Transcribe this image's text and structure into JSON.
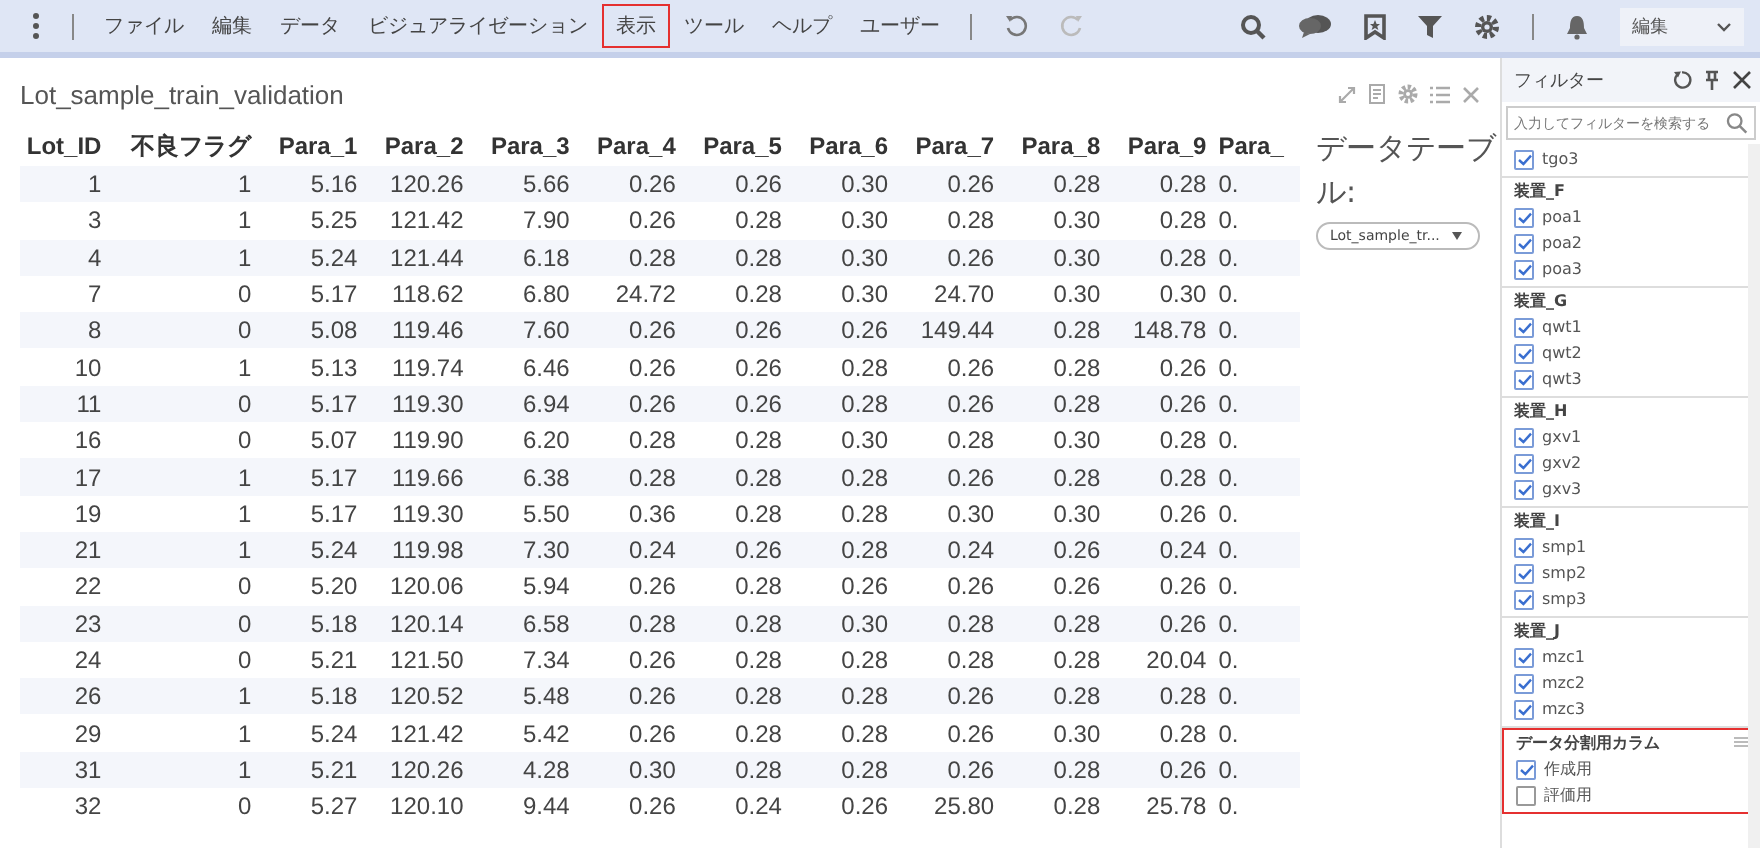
{
  "menu_bar": {
    "items": [
      {
        "label": "ファイル",
        "highlighted": false
      },
      {
        "label": "編集",
        "highlighted": false
      },
      {
        "label": "データ",
        "highlighted": false
      },
      {
        "label": "ビジュアライゼーション",
        "highlighted": false
      },
      {
        "label": "表示",
        "highlighted": true
      },
      {
        "label": "ツール",
        "highlighted": false
      },
      {
        "label": "ヘルプ",
        "highlighted": false
      },
      {
        "label": "ユーザー",
        "highlighted": false
      }
    ],
    "mode_dropdown": "編集"
  },
  "visualization": {
    "title": "Lot_sample_train_validation",
    "table": {
      "columns": [
        "Lot_ID",
        "不良フラグ",
        "Para_1",
        "Para_2",
        "Para_3",
        "Para_4",
        "Para_5",
        "Para_6",
        "Para_7",
        "Para_8",
        "Para_9",
        "Para_"
      ],
      "rows": [
        [
          "1",
          "1",
          "5.16",
          "120.26",
          "5.66",
          "0.26",
          "0.26",
          "0.30",
          "0.26",
          "0.28",
          "0.28",
          "0."
        ],
        [
          "3",
          "1",
          "5.25",
          "121.42",
          "7.90",
          "0.26",
          "0.28",
          "0.30",
          "0.28",
          "0.30",
          "0.28",
          "0."
        ],
        [
          "4",
          "1",
          "5.24",
          "121.44",
          "6.18",
          "0.28",
          "0.28",
          "0.30",
          "0.26",
          "0.30",
          "0.28",
          "0."
        ],
        [
          "7",
          "0",
          "5.17",
          "118.62",
          "6.80",
          "24.72",
          "0.28",
          "0.30",
          "24.70",
          "0.30",
          "0.30",
          "0."
        ],
        [
          "8",
          "0",
          "5.08",
          "119.46",
          "7.60",
          "0.26",
          "0.26",
          "0.26",
          "149.44",
          "0.28",
          "148.78",
          "0."
        ],
        [
          "10",
          "1",
          "5.13",
          "119.74",
          "6.46",
          "0.26",
          "0.26",
          "0.28",
          "0.26",
          "0.28",
          "0.26",
          "0."
        ],
        [
          "11",
          "0",
          "5.17",
          "119.30",
          "6.94",
          "0.26",
          "0.26",
          "0.28",
          "0.26",
          "0.28",
          "0.26",
          "0."
        ],
        [
          "16",
          "0",
          "5.07",
          "119.90",
          "6.20",
          "0.28",
          "0.28",
          "0.30",
          "0.28",
          "0.30",
          "0.28",
          "0."
        ],
        [
          "17",
          "1",
          "5.17",
          "119.66",
          "6.38",
          "0.28",
          "0.28",
          "0.28",
          "0.26",
          "0.28",
          "0.28",
          "0."
        ],
        [
          "19",
          "1",
          "5.17",
          "119.30",
          "5.50",
          "0.36",
          "0.28",
          "0.28",
          "0.30",
          "0.30",
          "0.26",
          "0."
        ],
        [
          "21",
          "1",
          "5.24",
          "119.98",
          "7.30",
          "0.24",
          "0.26",
          "0.28",
          "0.24",
          "0.26",
          "0.24",
          "0."
        ],
        [
          "22",
          "0",
          "5.20",
          "120.06",
          "5.94",
          "0.26",
          "0.28",
          "0.26",
          "0.26",
          "0.26",
          "0.26",
          "0."
        ],
        [
          "23",
          "0",
          "5.18",
          "120.14",
          "6.58",
          "0.28",
          "0.28",
          "0.30",
          "0.28",
          "0.28",
          "0.26",
          "0."
        ],
        [
          "24",
          "0",
          "5.21",
          "121.50",
          "7.34",
          "0.26",
          "0.28",
          "0.28",
          "0.28",
          "0.28",
          "20.04",
          "0."
        ],
        [
          "26",
          "1",
          "5.18",
          "120.52",
          "5.48",
          "0.26",
          "0.28",
          "0.28",
          "0.26",
          "0.28",
          "0.28",
          "0."
        ],
        [
          "29",
          "1",
          "5.24",
          "121.42",
          "5.42",
          "0.26",
          "0.28",
          "0.28",
          "0.26",
          "0.30",
          "0.28",
          "0."
        ],
        [
          "31",
          "1",
          "5.21",
          "120.26",
          "4.28",
          "0.30",
          "0.28",
          "0.28",
          "0.26",
          "0.28",
          "0.26",
          "0."
        ],
        [
          "32",
          "0",
          "5.27",
          "120.10",
          "9.44",
          "0.26",
          "0.24",
          "0.26",
          "25.80",
          "0.28",
          "25.78",
          "0."
        ]
      ]
    },
    "data_table_label": "データテーブル:",
    "data_table_select": "Lot_sample_tr..."
  },
  "filter_panel": {
    "title": "フィルター",
    "search": {
      "placeholder": "入力してフィルターを検索する"
    },
    "groups": [
      {
        "items": [
          {
            "label": "tgo3",
            "checked": true
          }
        ],
        "highlighted": false
      },
      {
        "title": "装置_F",
        "items": [
          {
            "label": "poa1",
            "checked": true
          },
          {
            "label": "poa2",
            "checked": true
          },
          {
            "label": "poa3",
            "checked": true
          }
        ],
        "highlighted": false
      },
      {
        "title": "装置_G",
        "items": [
          {
            "label": "qwt1",
            "checked": true
          },
          {
            "label": "qwt2",
            "checked": true
          },
          {
            "label": "qwt3",
            "checked": true
          }
        ],
        "highlighted": false
      },
      {
        "title": "装置_H",
        "items": [
          {
            "label": "gxv1",
            "checked": true
          },
          {
            "label": "gxv2",
            "checked": true
          },
          {
            "label": "gxv3",
            "checked": true
          }
        ],
        "highlighted": false
      },
      {
        "title": "装置_I",
        "items": [
          {
            "label": "smp1",
            "checked": true
          },
          {
            "label": "smp2",
            "checked": true
          },
          {
            "label": "smp3",
            "checked": true
          }
        ],
        "highlighted": false
      },
      {
        "title": "装置_J",
        "items": [
          {
            "label": "mzc1",
            "checked": true
          },
          {
            "label": "mzc2",
            "checked": true
          },
          {
            "label": "mzc3",
            "checked": true
          }
        ],
        "highlighted": false
      },
      {
        "title": "データ分割用カラム",
        "items": [
          {
            "label": "作成用",
            "checked": true
          },
          {
            "label": "評価用",
            "checked": false
          }
        ],
        "highlighted": true
      }
    ]
  }
}
